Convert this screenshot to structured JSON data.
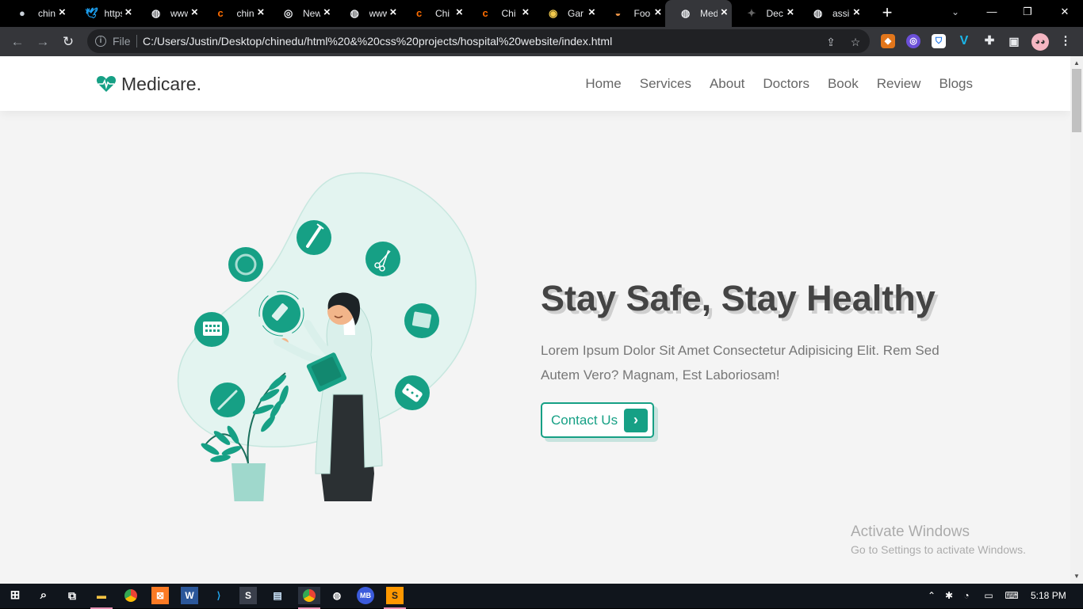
{
  "browser": {
    "tabs": [
      {
        "icon": "github-icon",
        "title": "chinedu"
      },
      {
        "icon": "twitter-icon",
        "title": "https"
      },
      {
        "icon": "globe-icon",
        "title": "www"
      },
      {
        "icon": "codepen-c-icon",
        "title": "chinedu"
      },
      {
        "icon": "chrome-icon",
        "title": "New"
      },
      {
        "icon": "globe-icon",
        "title": "www"
      },
      {
        "icon": "codepen-c-icon",
        "title": "Chi"
      },
      {
        "icon": "codepen-c-icon",
        "title": "Chi"
      },
      {
        "icon": "gamepad-icon",
        "title": "Gar"
      },
      {
        "icon": "burger-icon",
        "title": "Foo"
      },
      {
        "icon": "globe-icon",
        "title": "Medicare",
        "active": true
      },
      {
        "icon": "spark-icon",
        "title": "Dec"
      },
      {
        "icon": "globe-icon",
        "title": "assi"
      }
    ],
    "new_tab": "+",
    "window_controls": {
      "minimize": "—",
      "restore": "❐",
      "close": "✕"
    },
    "address": {
      "scheme_label": "File",
      "url": "C:/Users/Justin/Desktop/chinedu/html%20&%20css%20projects/hospital%20website/index.html"
    }
  },
  "site": {
    "brand": "Medicare.",
    "nav": [
      "Home",
      "Services",
      "About",
      "Doctors",
      "Book",
      "Review",
      "Blogs"
    ],
    "hero": {
      "title": "Stay Safe, Stay Healthy",
      "description": "Lorem Ipsum Dolor Sit Amet Consectetur Adipisicing Elit. Rem Sed Autem Vero? Magnam, Est Laboriosam!",
      "button": "Contact Us",
      "button_icon": "chevron-right-icon"
    },
    "accent_color": "#16a085"
  },
  "watermark": {
    "line1": "Activate Windows",
    "line2": "Go to Settings to activate Windows."
  },
  "taskbar": {
    "clock": "5:18 PM"
  }
}
